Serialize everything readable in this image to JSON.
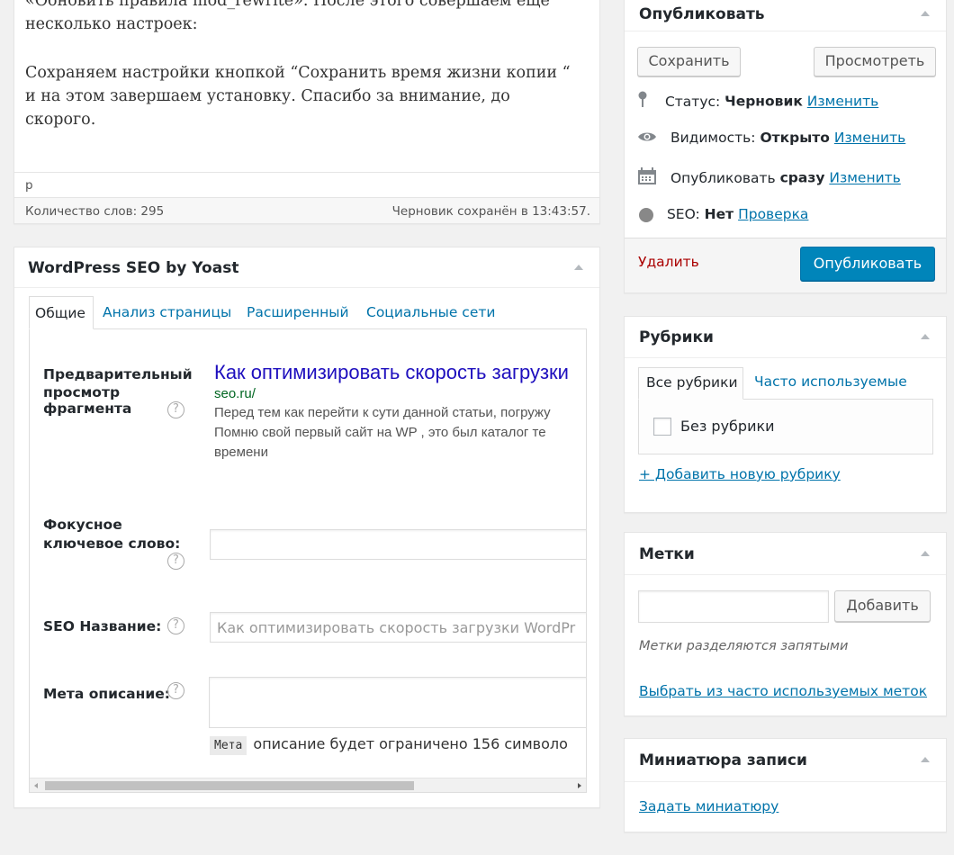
{
  "editor": {
    "para1_line1": "«Обновить правила mod_rewrite». После этого совершаем еще",
    "para1_line2": "несколько настроек:",
    "para2_line1": "Сохраняем настройки кнопкой “Сохранить время жизни копии “",
    "para2_line2": "и на этом завершаем установку. Спасибо за внимание, до",
    "para2_line3": "скорого.",
    "path": "p",
    "word_count": "Количество слов: 295",
    "draft_saved": "Черновик сохранён в 13:43:57."
  },
  "seo": {
    "title": "WordPress SEO by Yoast",
    "tabs": [
      "Общие",
      "Анализ страницы",
      "Расширенный",
      "Социальные сети"
    ],
    "snippet_label_line1": "Предварительный",
    "snippet_label_line2": "просмотр",
    "snippet_label_line3": "фрагмента",
    "snippet_title": "Как оптимизировать скорость загрузки",
    "snippet_url": "seo.ru/",
    "snippet_desc_line1": "Перед тем как перейти к сути данной статьи, погружу",
    "snippet_desc_line2": "Помню свой первый сайт на WP , это был каталог те",
    "snippet_desc_line3": "времени",
    "focus_label_line1": "Фокусное",
    "focus_label_line2": "ключевое слово:",
    "focus_value": "",
    "seo_title_label": "SEO Название:",
    "seo_title_placeholder": "Как оптимизировать скорость загрузки WordPr",
    "meta_label": "Мета описание:",
    "meta_value": "",
    "meta_code": "Мета",
    "meta_note": "описание будет ограничено 156 символо",
    "help": "?"
  },
  "publish": {
    "title": "Опубликовать",
    "save": "Сохранить",
    "preview": "Просмотреть",
    "status_label": "Статус:",
    "status_value": "Черновик",
    "visibility_label": "Видимость:",
    "visibility_value": "Открыто",
    "publish_label": "Опубликовать",
    "publish_value": "сразу",
    "seo_label": "SEO:",
    "seo_value": "Нет",
    "seo_link": "Проверка",
    "edit": "Изменить",
    "delete": "Удалить",
    "publish_button": "Опубликовать"
  },
  "categories": {
    "title": "Рубрики",
    "tab_all": "Все рубрики",
    "tab_popular": "Часто используемые",
    "item": "Без рубрики",
    "add_new": "+ Добавить новую рубрику"
  },
  "tags": {
    "title": "Метки",
    "add": "Добавить",
    "input_value": "",
    "hint": "Метки разделяются запятыми",
    "choose": "Выбрать из часто используемых меток"
  },
  "thumbnail": {
    "title": "Миниатюра записи",
    "set": "Задать миниатюру"
  },
  "colors": {
    "primary": "#0085ba",
    "link": "#0073aa",
    "delete": "#a00",
    "snippet_title": "#1e0fbe",
    "snippet_url": "#006621"
  }
}
